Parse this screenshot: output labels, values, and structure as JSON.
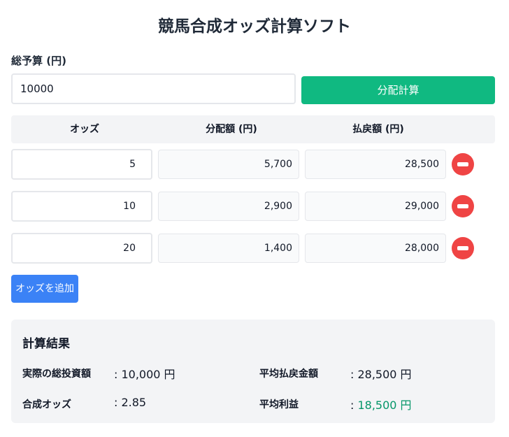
{
  "app": {
    "title": "競馬合成オッズ計算ソフト"
  },
  "budget": {
    "label": "総予算 (円)",
    "value": "10000"
  },
  "calc_button": {
    "label": "分配計算"
  },
  "table": {
    "headers": {
      "odds": "オッズ",
      "allocation": "分配額 (円)",
      "payout": "払戻額 (円)"
    },
    "rows": [
      {
        "odds": "5",
        "allocation": "5,700",
        "payout": "28,500"
      },
      {
        "odds": "10",
        "allocation": "2,900",
        "payout": "29,000"
      },
      {
        "odds": "20",
        "allocation": "1,400",
        "payout": "28,000"
      }
    ]
  },
  "add_button": {
    "label": "オッズを追加"
  },
  "results": {
    "title": "計算結果",
    "total_invest": {
      "label": "実際の総投資額",
      "value": ": 10,000 円"
    },
    "avg_payout": {
      "label": "平均払戻金額",
      "value": ": 28,500 円"
    },
    "combined_odds": {
      "label": "合成オッズ",
      "value": ": 2.85"
    },
    "avg_profit": {
      "label": "平均利益",
      "value_prefix": ": ",
      "value": "18,500 円"
    }
  },
  "colors": {
    "calc_button": "#10b981",
    "add_button": "#3b82f6",
    "remove_button": "#ef4444",
    "profit_text": "#059669"
  },
  "icons": {
    "remove": "minus-circle-icon"
  }
}
